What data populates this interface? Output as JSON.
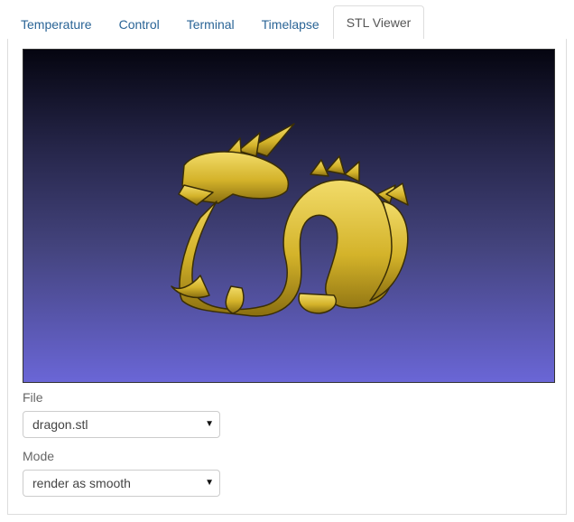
{
  "tabs": [
    {
      "label": "Temperature",
      "active": false
    },
    {
      "label": "Control",
      "active": false
    },
    {
      "label": "Terminal",
      "active": false
    },
    {
      "label": "Timelapse",
      "active": false
    },
    {
      "label": "STL Viewer",
      "active": true
    }
  ],
  "viewer": {
    "model_icon": "dragon-model",
    "model_color": "#d4b32a",
    "background_top": "#050510",
    "background_bottom": "#6a66d6"
  },
  "file": {
    "label": "File",
    "selected": "dragon.stl"
  },
  "mode": {
    "label": "Mode",
    "selected": "render as smooth"
  },
  "colors": {
    "tab_link": "#2a6496",
    "tab_active": "#555555",
    "border": "#dddddd"
  }
}
